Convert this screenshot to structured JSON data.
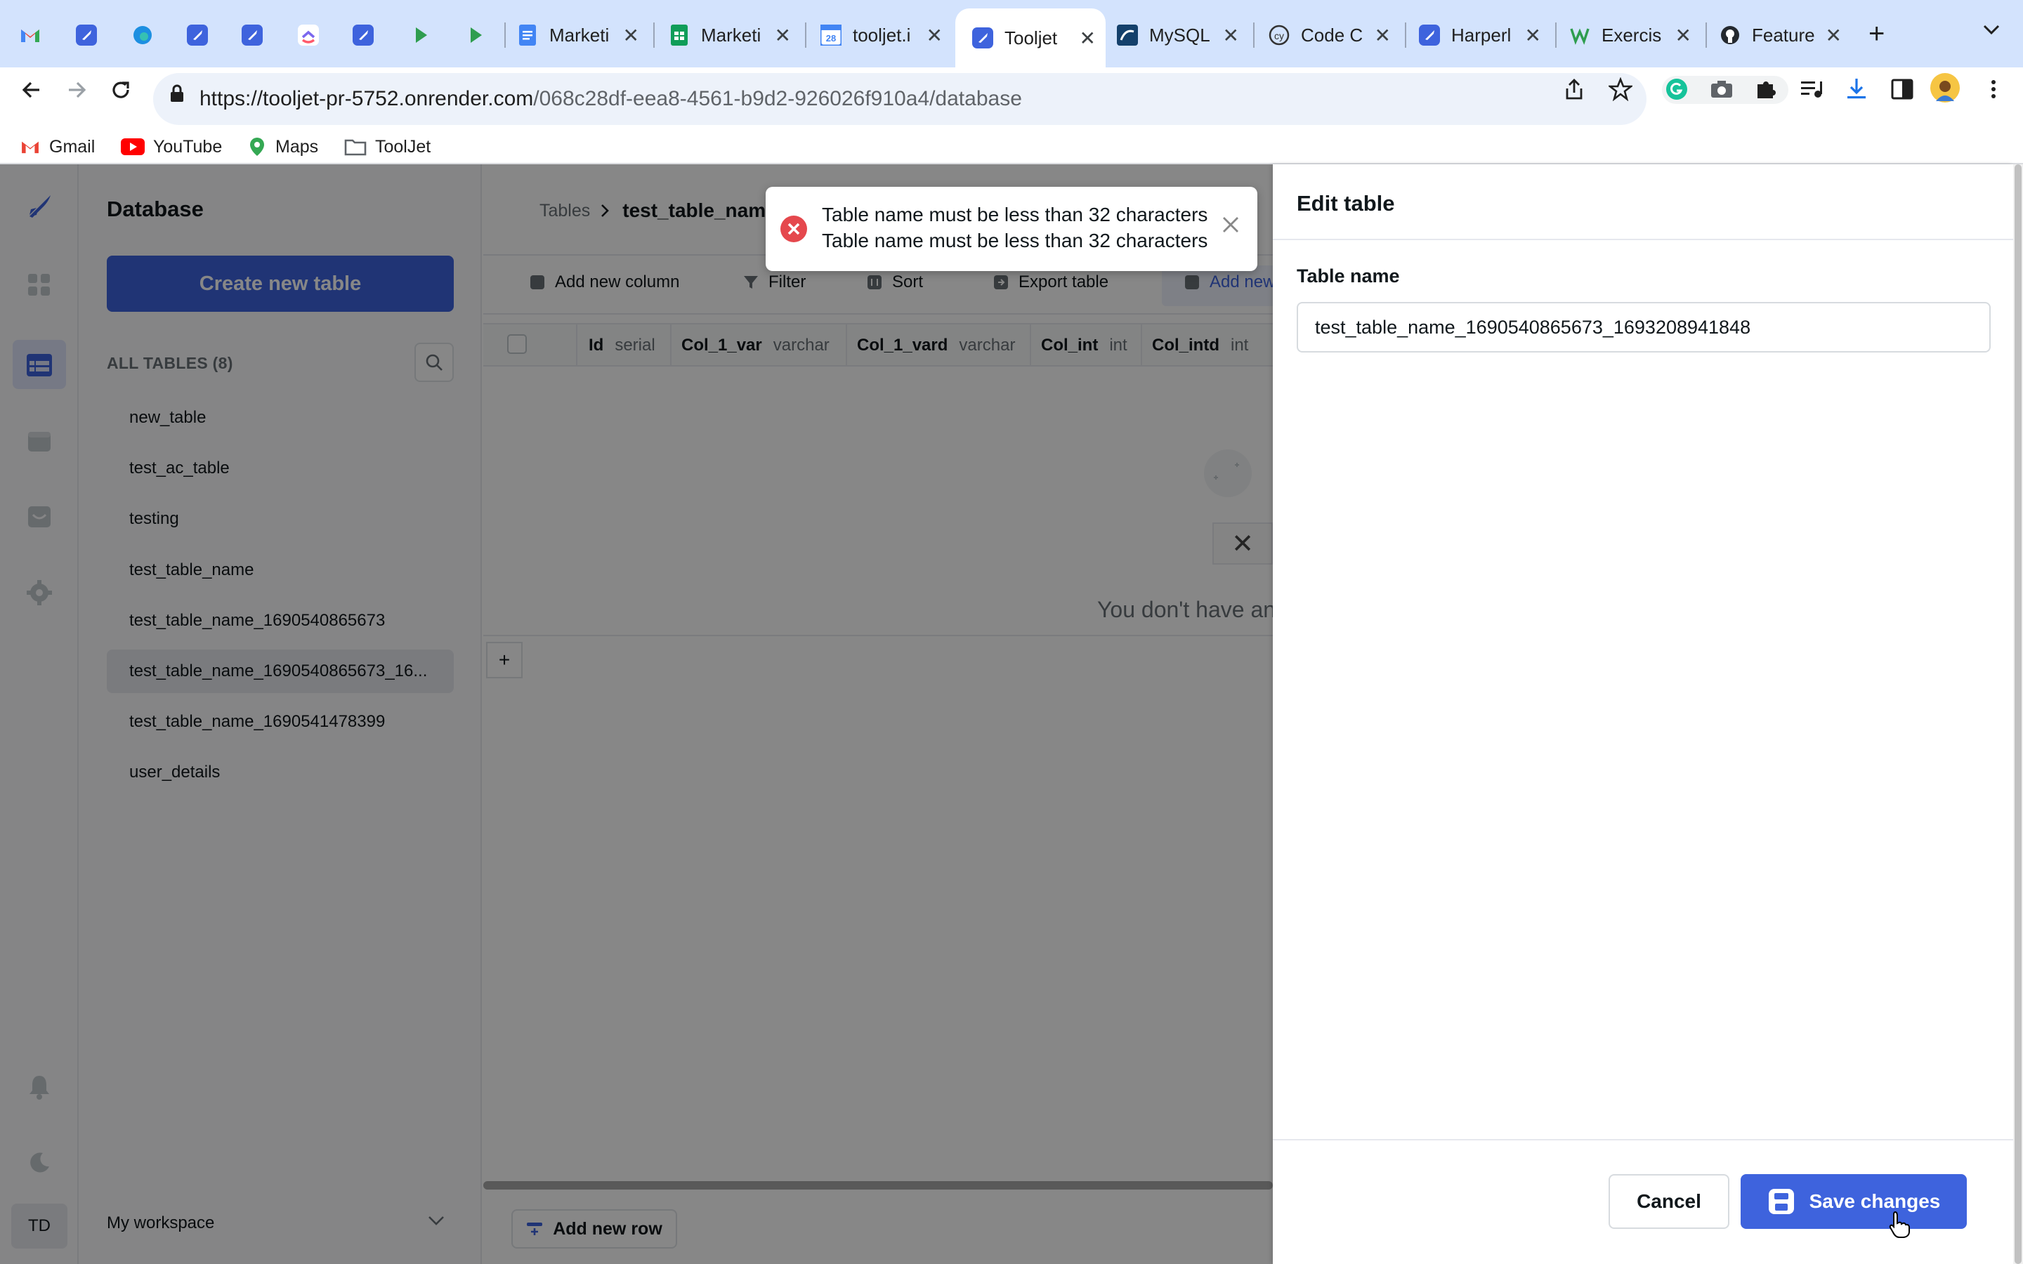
{
  "browser": {
    "tabs": [
      {
        "title": "",
        "icon": "gmail-icon"
      },
      {
        "title": "",
        "icon": "tooljet-icon"
      },
      {
        "title": "",
        "icon": "edge-icon"
      },
      {
        "title": "",
        "icon": "tooljet-icon"
      },
      {
        "title": "",
        "icon": "tooljet-icon"
      },
      {
        "title": "",
        "icon": "clickup-icon"
      },
      {
        "title": "",
        "icon": "tooljet-icon"
      },
      {
        "title": "",
        "icon": "play-icon"
      },
      {
        "title": "",
        "icon": "play-icon"
      },
      {
        "title": "Marketi",
        "icon": "docs-icon"
      },
      {
        "title": "Marketi",
        "icon": "sheets-icon"
      },
      {
        "title": "tooljet.i",
        "icon": "calendar-icon"
      },
      {
        "title": "Tooljet",
        "icon": "tooljet-icon"
      },
      {
        "title": "MySQL",
        "icon": "mysql-icon"
      },
      {
        "title": "Code C",
        "icon": "cy-icon"
      },
      {
        "title": "Harperl",
        "icon": "tooljet-icon"
      },
      {
        "title": "Exercis",
        "icon": "w-icon"
      },
      {
        "title": "Feature",
        "icon": "github-icon"
      }
    ],
    "url_host": "https://tooljet-pr-5752.onrender.com",
    "url_path": "/068c28df-eea8-4561-b9d2-926026f910a4/database",
    "bookmarks": [
      "Gmail",
      "YouTube",
      "Maps",
      "ToolJet"
    ]
  },
  "sidebar": {
    "title": "Database",
    "create_button": "Create new table",
    "all_tables_label": "ALL TABLES (8)",
    "tables": [
      "new_table",
      "test_ac_table",
      "testing",
      "test_table_name",
      "test_table_name_1690540865673",
      "test_table_name_1690540865673_16...",
      "test_table_name_1690541478399",
      "user_details"
    ],
    "selected_index": 5,
    "workspace": "My workspace",
    "avatar": "TD"
  },
  "main": {
    "breadcrumb_root": "Tables",
    "breadcrumb_current": "test_table_name",
    "toolbar": {
      "add_column": "Add new column",
      "filter": "Filter",
      "sort": "Sort",
      "export": "Export table",
      "add_new": "Add new"
    },
    "columns": [
      {
        "name": "Id",
        "type": "serial"
      },
      {
        "name": "Col_1_var",
        "type": "varchar"
      },
      {
        "name": "Col_1_vard",
        "type": "varchar"
      },
      {
        "name": "Col_int",
        "type": "int"
      },
      {
        "name": "Col_intd",
        "type": "int"
      }
    ],
    "empty_message": "You don't have an",
    "add_row": "Add new row"
  },
  "toast": {
    "line1": "Table name must be less than 32 characters",
    "line2": "Table name must be less than 32 characters"
  },
  "drawer": {
    "title": "Edit table",
    "field_label": "Table name",
    "field_value": "test_table_name_1690540865673_1693208941848",
    "cancel": "Cancel",
    "save": "Save changes"
  },
  "colors": {
    "primary": "#3e63dd",
    "tab_strip": "#d3e3fd",
    "error": "#e5484d"
  }
}
